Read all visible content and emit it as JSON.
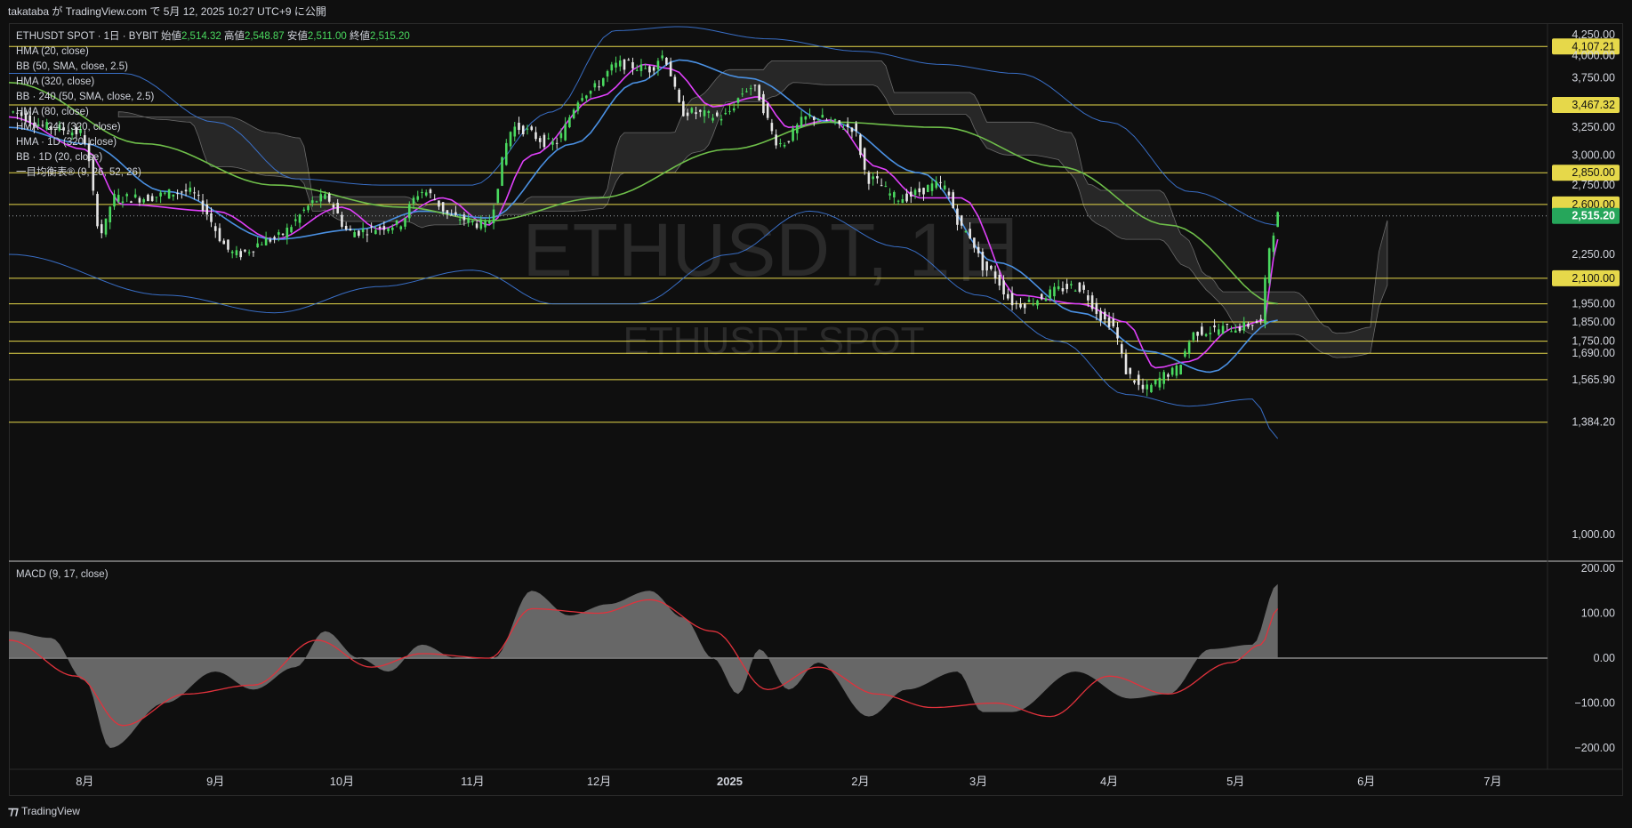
{
  "header": {
    "publish_line": "takataba が TradingView.com で 5月 12, 2025 10:27 UTC+9 に公開"
  },
  "legend": {
    "symbol_line": "ETHUSDT SPOT · 1日 · BYBIT",
    "open_label": "始値",
    "open_value": "2,514.32",
    "high_label": "高値",
    "high_value": "2,548.87",
    "low_label": "安値",
    "low_value": "2,511.00",
    "close_label": "終値",
    "close_value": "2,515.20",
    "indicators": [
      "HMA (20, close)",
      "BB (50, SMA, close, 2.5)",
      "HMA (320, close)",
      "BB · 240 (50, SMA, close, 2.5)",
      "HMA (80, close)",
      "HMA · 240 (320, close)",
      "HMA · 1D (320, close)",
      "BB · 1D (20, close)",
      "一目均衡表® (9, 26, 52, 26)"
    ]
  },
  "watermark": {
    "line1": "ETHUSDT, 1日",
    "line2": "ETHUSDT SPOT"
  },
  "macd_label": "MACD (9, 17, close)",
  "footer": {
    "logo": "⁊⁊",
    "brand": "TradingView"
  },
  "colors": {
    "background": "#0f0f0f",
    "candle_up": "#4ad95f",
    "candle_down": "#e6e6e6",
    "hma20": "#e040fb",
    "hma80": "#4a90e2",
    "hma320": "#6fbf4a",
    "bollinger": "#3d78d8",
    "level_line": "#e6d84a",
    "current_price_bg": "#26a65b",
    "macd_hist": "#777777",
    "macd_signal": "#e0323c"
  },
  "chart_data": {
    "type": "candlestick",
    "title": "ETHUSDT SPOT · 1日 · BYBIT",
    "price_axis": {
      "ticks": [
        1000,
        2250,
        2750,
        3000,
        3250,
        3750,
        4000,
        4250
      ],
      "tick_labels": [
        "1,000.00",
        "2,250.00",
        "2,750.00",
        "3,000.00",
        "3,250.00",
        "3,750.00",
        "4,000.00",
        "4,250.00"
      ],
      "scale": "log",
      "range": [
        1000,
        4300
      ]
    },
    "time_axis": {
      "labels": [
        "8月",
        "9月",
        "10月",
        "11月",
        "12月",
        "2025",
        "2月",
        "3月",
        "4月",
        "5月",
        "6月",
        "7月"
      ],
      "range": [
        "2024-07-14",
        "2025-07-14"
      ]
    },
    "horizontal_levels": [
      {
        "value": 4107.21,
        "label": "4,107.21",
        "highlight": true
      },
      {
        "value": 3467.32,
        "label": "3,467.32",
        "highlight": true
      },
      {
        "value": 2850.0,
        "label": "2,850.00",
        "highlight": true
      },
      {
        "value": 2600.0,
        "label": "2,600.00",
        "highlight": true
      },
      {
        "value": 2100.0,
        "label": "2,100.00",
        "highlight": true
      },
      {
        "value": 1950.0,
        "label": "1,950.00",
        "highlight": false
      },
      {
        "value": 1850.0,
        "label": "1,850.00",
        "highlight": false
      },
      {
        "value": 1750.0,
        "label": "1,750.00",
        "highlight": false
      },
      {
        "value": 1690.0,
        "label": "1,690.00",
        "highlight": false
      },
      {
        "value": 1565.9,
        "label": "1,565.90",
        "highlight": false
      },
      {
        "value": 1384.2,
        "label": "1,384.20",
        "highlight": false
      }
    ],
    "current_price": {
      "value": 2515.2,
      "label": "2,515.20"
    },
    "price_path": [
      [
        "2024-07-14",
        3400
      ],
      [
        "2024-07-24",
        3250
      ],
      [
        "2024-07-31",
        3200
      ],
      [
        "2024-08-05",
        2400
      ],
      [
        "2024-08-08",
        2650
      ],
      [
        "2024-08-14",
        2650
      ],
      [
        "2024-08-25",
        2700
      ],
      [
        "2024-09-06",
        2250
      ],
      [
        "2024-09-14",
        2350
      ],
      [
        "2024-09-27",
        2650
      ],
      [
        "2024-10-03",
        2400
      ],
      [
        "2024-10-14",
        2450
      ],
      [
        "2024-10-20",
        2700
      ],
      [
        "2024-10-28",
        2500
      ],
      [
        "2024-11-04",
        2450
      ],
      [
        "2024-11-11",
        3250
      ],
      [
        "2024-11-20",
        3100
      ],
      [
        "2024-11-28",
        3600
      ],
      [
        "2024-12-06",
        3900
      ],
      [
        "2024-12-13",
        3850
      ],
      [
        "2024-12-16",
        4000
      ],
      [
        "2024-12-21",
        3400
      ],
      [
        "2024-12-30",
        3350
      ],
      [
        "2025-01-06",
        3650
      ],
      [
        "2025-01-13",
        3100
      ],
      [
        "2025-01-20",
        3350
      ],
      [
        "2025-01-30",
        3250
      ],
      [
        "2025-02-03",
        2800
      ],
      [
        "2025-02-10",
        2650
      ],
      [
        "2025-02-20",
        2750
      ],
      [
        "2025-02-26",
        2400
      ],
      [
        "2025-03-03",
        2150
      ],
      [
        "2025-03-10",
        1950
      ],
      [
        "2025-03-24",
        2050
      ],
      [
        "2025-04-01",
        1850
      ],
      [
        "2025-04-06",
        1580
      ],
      [
        "2025-04-09",
        1520
      ],
      [
        "2025-04-16",
        1600
      ],
      [
        "2025-04-22",
        1800
      ],
      [
        "2025-05-01",
        1820
      ],
      [
        "2025-05-07",
        1850
      ],
      [
        "2025-05-09",
        2300
      ],
      [
        "2025-05-11",
        2520
      ]
    ],
    "ma_series": [
      {
        "name": "HMA (20, close)",
        "color": "#e040fb",
        "values": [
          [
            "2024-07-14",
            3350
          ],
          [
            "2024-08-01",
            3050
          ],
          [
            "2024-08-10",
            2600
          ],
          [
            "2024-09-01",
            2550
          ],
          [
            "2024-09-15",
            2350
          ],
          [
            "2024-10-01",
            2580
          ],
          [
            "2024-10-10",
            2420
          ],
          [
            "2024-10-25",
            2650
          ],
          [
            "2024-11-05",
            2450
          ],
          [
            "2024-11-15",
            3000
          ],
          [
            "2024-12-01",
            3550
          ],
          [
            "2024-12-12",
            3900
          ],
          [
            "2024-12-18",
            3850
          ],
          [
            "2024-12-28",
            3450
          ],
          [
            "2025-01-08",
            3550
          ],
          [
            "2025-01-15",
            3250
          ],
          [
            "2025-01-25",
            3320
          ],
          [
            "2025-02-05",
            2900
          ],
          [
            "2025-02-15",
            2650
          ],
          [
            "2025-02-25",
            2650
          ],
          [
            "2025-03-10",
            2000
          ],
          [
            "2025-03-25",
            1950
          ],
          [
            "2025-04-05",
            1850
          ],
          [
            "2025-04-12",
            1620
          ],
          [
            "2025-04-20",
            1650
          ],
          [
            "2025-05-01",
            1820
          ],
          [
            "2025-05-08",
            1860
          ],
          [
            "2025-05-11",
            2350
          ]
        ]
      },
      {
        "name": "HMA (80, close)",
        "color": "#4a90e2",
        "values": [
          [
            "2024-07-14",
            3250
          ],
          [
            "2024-08-01",
            3100
          ],
          [
            "2024-08-20",
            2700
          ],
          [
            "2024-09-15",
            2350
          ],
          [
            "2024-10-05",
            2420
          ],
          [
            "2024-10-20",
            2550
          ],
          [
            "2024-11-05",
            2500
          ],
          [
            "2024-11-25",
            3100
          ],
          [
            "2024-12-10",
            3700
          ],
          [
            "2024-12-20",
            3950
          ],
          [
            "2025-01-05",
            3750
          ],
          [
            "2025-01-25",
            3300
          ],
          [
            "2025-02-15",
            2850
          ],
          [
            "2025-03-05",
            2200
          ],
          [
            "2025-03-25",
            1900
          ],
          [
            "2025-04-10",
            1700
          ],
          [
            "2025-04-25",
            1600
          ],
          [
            "2025-05-11",
            1860
          ]
        ]
      },
      {
        "name": "HMA (320, close)",
        "color": "#6fbf4a",
        "values": [
          [
            "2024-07-14",
            3700
          ],
          [
            "2024-08-15",
            3100
          ],
          [
            "2024-09-15",
            2750
          ],
          [
            "2024-10-15",
            2580
          ],
          [
            "2024-11-05",
            2480
          ],
          [
            "2024-12-01",
            2650
          ],
          [
            "2025-01-01",
            3050
          ],
          [
            "2025-01-25",
            3300
          ],
          [
            "2025-02-20",
            3250
          ],
          [
            "2025-03-20",
            2900
          ],
          [
            "2025-04-15",
            2450
          ],
          [
            "2025-05-11",
            1950
          ]
        ]
      },
      {
        "name": "BB upper",
        "color": "#3d78d8",
        "values": [
          [
            "2024-07-14",
            3800
          ],
          [
            "2024-08-10",
            3800
          ],
          [
            "2024-09-01",
            3300
          ],
          [
            "2024-09-20",
            2800
          ],
          [
            "2024-10-10",
            2750
          ],
          [
            "2024-11-01",
            2750
          ],
          [
            "2024-11-20",
            3400
          ],
          [
            "2024-12-05",
            4300
          ],
          [
            "2024-12-20",
            4350
          ],
          [
            "2025-01-10",
            4200
          ],
          [
            "2025-02-01",
            4050
          ],
          [
            "2025-02-20",
            3900
          ],
          [
            "2025-03-10",
            3800
          ],
          [
            "2025-04-01",
            3300
          ],
          [
            "2025-04-20",
            2700
          ],
          [
            "2025-05-11",
            2450
          ]
        ]
      },
      {
        "name": "BB lower",
        "color": "#3d78d8",
        "values": [
          [
            "2024-07-14",
            2250
          ],
          [
            "2024-08-20",
            2000
          ],
          [
            "2024-09-15",
            1900
          ],
          [
            "2024-10-10",
            2050
          ],
          [
            "2024-11-01",
            2150
          ],
          [
            "2024-11-20",
            1950
          ],
          [
            "2024-12-10",
            1950
          ],
          [
            "2025-01-01",
            2250
          ],
          [
            "2025-01-20",
            2550
          ],
          [
            "2025-02-10",
            2300
          ],
          [
            "2025-03-01",
            2000
          ],
          [
            "2025-03-20",
            1750
          ],
          [
            "2025-04-05",
            1500
          ],
          [
            "2025-04-20",
            1450
          ],
          [
            "2025-05-05",
            1480
          ],
          [
            "2025-05-11",
            1320
          ]
        ]
      }
    ],
    "macd": {
      "label": "MACD (9, 17, close)",
      "ticks": [
        -200,
        -100,
        0,
        100,
        200
      ],
      "tick_labels": [
        "−200.00",
        "−100.00",
        "0.00",
        "100.00",
        "200.00"
      ],
      "range": [
        -230,
        200
      ],
      "histogram": [
        [
          "2024-07-14",
          60
        ],
        [
          "2024-07-24",
          45
        ],
        [
          "2024-08-01",
          -50
        ],
        [
          "2024-08-07",
          -200
        ],
        [
          "2024-08-20",
          -100
        ],
        [
          "2024-09-01",
          -30
        ],
        [
          "2024-09-10",
          -70
        ],
        [
          "2024-09-20",
          -20
        ],
        [
          "2024-09-27",
          60
        ],
        [
          "2024-10-05",
          0
        ],
        [
          "2024-10-12",
          -30
        ],
        [
          "2024-10-20",
          30
        ],
        [
          "2024-10-28",
          0
        ],
        [
          "2024-11-06",
          0
        ],
        [
          "2024-11-15",
          150
        ],
        [
          "2024-11-24",
          95
        ],
        [
          "2024-12-03",
          120
        ],
        [
          "2024-12-13",
          150
        ],
        [
          "2024-12-21",
          90
        ],
        [
          "2024-12-28",
          0
        ],
        [
          "2025-01-03",
          -80
        ],
        [
          "2025-01-08",
          20
        ],
        [
          "2025-01-15",
          -70
        ],
        [
          "2025-01-22",
          -10
        ],
        [
          "2025-02-03",
          -130
        ],
        [
          "2025-02-12",
          -70
        ],
        [
          "2025-02-24",
          -30
        ],
        [
          "2025-03-02",
          -120
        ],
        [
          "2025-03-09",
          -120
        ],
        [
          "2025-03-24",
          -30
        ],
        [
          "2025-04-06",
          -90
        ],
        [
          "2025-04-15",
          -80
        ],
        [
          "2025-04-25",
          20
        ],
        [
          "2025-05-05",
          30
        ],
        [
          "2025-05-11",
          165
        ]
      ],
      "signal": [
        [
          "2024-07-14",
          40
        ],
        [
          "2024-07-30",
          -40
        ],
        [
          "2024-08-10",
          -150
        ],
        [
          "2024-08-25",
          -80
        ],
        [
          "2024-09-10",
          -60
        ],
        [
          "2024-09-25",
          40
        ],
        [
          "2024-10-08",
          -20
        ],
        [
          "2024-10-20",
          10
        ],
        [
          "2024-11-05",
          0
        ],
        [
          "2024-11-15",
          110
        ],
        [
          "2024-12-01",
          100
        ],
        [
          "2024-12-13",
          130
        ],
        [
          "2024-12-28",
          60
        ],
        [
          "2025-01-10",
          -70
        ],
        [
          "2025-01-22",
          -20
        ],
        [
          "2025-02-05",
          -80
        ],
        [
          "2025-02-18",
          -110
        ],
        [
          "2025-03-05",
          -100
        ],
        [
          "2025-03-18",
          -130
        ],
        [
          "2025-04-01",
          -40
        ],
        [
          "2025-04-15",
          -80
        ],
        [
          "2025-04-30",
          -10
        ],
        [
          "2025-05-07",
          30
        ],
        [
          "2025-05-11",
          110
        ]
      ]
    }
  }
}
